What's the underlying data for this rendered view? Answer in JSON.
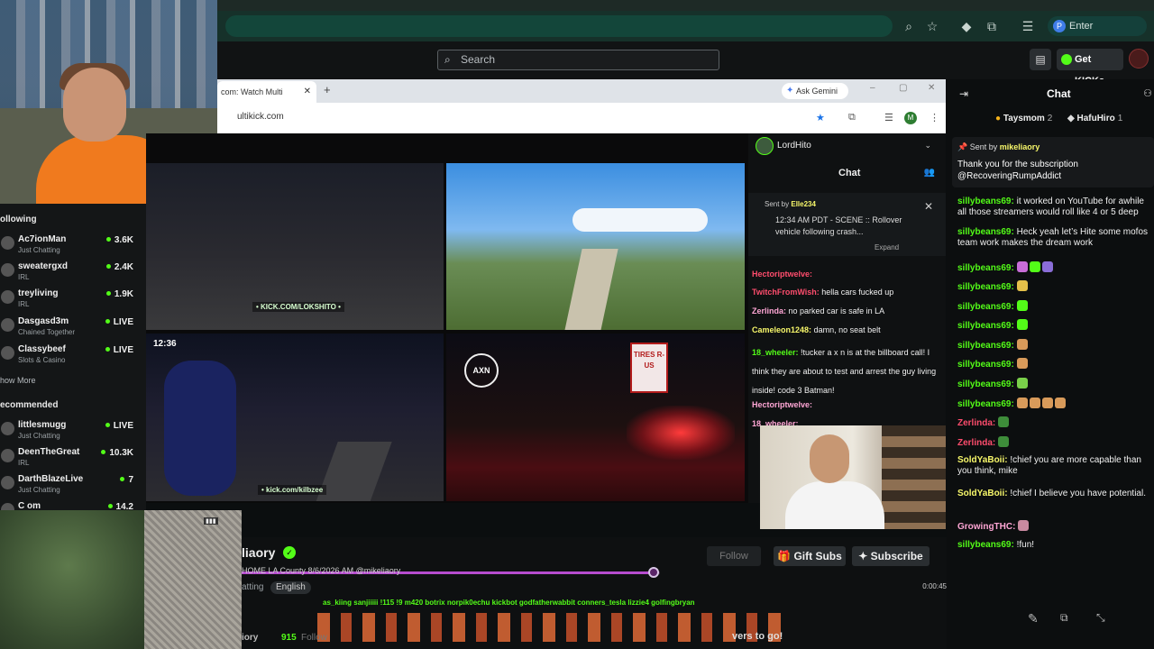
{
  "browser": {
    "passphrase_label": "Enter passphrase",
    "passphrase_badge": "P"
  },
  "kick": {
    "search_placeholder": "Search",
    "get_kicks_label": "Get KICKs"
  },
  "sidebar": {
    "following_title": "ollowing",
    "following": [
      {
        "name": "Ac7ionMan",
        "category": "Just Chatting",
        "viewers": "3.6K"
      },
      {
        "name": "sweatergxd",
        "category": "IRL",
        "viewers": "2.4K"
      },
      {
        "name": "treyliving",
        "category": "IRL",
        "viewers": "1.9K"
      },
      {
        "name": "Dasgasd3m",
        "category": "Chained Together",
        "viewers": "LIVE"
      },
      {
        "name": "Classybeef",
        "category": "Slots & Casino",
        "viewers": "LIVE"
      }
    ],
    "show_more": "how More",
    "recommended_title": "ecommended",
    "recommended": [
      {
        "name": "littlesmugg",
        "category": "Just Chatting",
        "viewers": "LIVE"
      },
      {
        "name": "DeenTheGreat",
        "category": "IRL",
        "viewers": "10.3K"
      },
      {
        "name": "DarthBlazeLive",
        "category": "Just Chatting",
        "viewers": "7"
      },
      {
        "name": "C   om",
        "category": "",
        "viewers": "14.2"
      }
    ]
  },
  "inner_browser": {
    "tab_title": "com: Watch Multi",
    "url": "ultikick.com",
    "ask_gemini": "Ask Gemini",
    "profile_initial": "M"
  },
  "streams": {
    "tile1_caption": "• KICK.COM/LOKSHITO •",
    "tile3_clock": "12:36",
    "tile3_caption": "• kick.com/kilbzee",
    "tile4_logo": "AXN",
    "tile4_sign": "TIRES R-US"
  },
  "inner_chat": {
    "user": "LordHito",
    "title": "Chat",
    "pinned_sender_label": "Sent by",
    "pinned_sender": "Elle234",
    "pinned_message": "12:34 AM PDT - SCENE :: Rollover vehicle following crash...",
    "expand_label": "Expand",
    "lines": [
      {
        "user": "Hectoriptwelve:",
        "text": ""
      },
      {
        "user": "TwitchFromWish:",
        "text": "hella cars fucked up"
      },
      {
        "user": "Zerlinda:",
        "text": "no parked car is safe in LA"
      },
      {
        "user": "Cameleon1248:",
        "text": "damn, no seat belt"
      },
      {
        "user": "18_wheeler:",
        "text": "!tucker a x n is at the billboard call! I think they are about to test and arrest the guy living inside! code 3 Batman!"
      },
      {
        "user": "Hectoriptwelve:",
        "text": ""
      },
      {
        "user": "18_wheeler:",
        "text": ""
      }
    ]
  },
  "info": {
    "streamer": "liaory",
    "title": "HOME LA County 8/6/2026 AM @mikeliaory",
    "category": "atting",
    "language": "English",
    "follow_label": "Follow",
    "gift_subs_label": "Gift Subs",
    "subscribe_label": "Subscribe",
    "overlay_names": "as_kiing    sanjiiiii  !115  !9   m420   botrix   norpik0echu   kickbot      godfatherwabbit   conners_tesla   lizzie4   golfingbryan",
    "footer_name": "iory",
    "footer_followers": "915",
    "footer_follow": "Follow",
    "footer_cta": "vers to go!",
    "time": "0:00:45",
    "progress": 0.985
  },
  "chat": {
    "title": "Chat",
    "gifters": [
      {
        "name": "Taysmom",
        "count": "2"
      },
      {
        "name": "HafuHiro",
        "count": "1"
      }
    ],
    "pinned_label": "Sent by",
    "pinned_sender": "mikeliaory",
    "pinned_message": "Thank you for the subscription @RecoveringRumpAddict",
    "lines": [
      {
        "user": "sillybeans69:",
        "text": "it worked on YouTube for awhile all those streamers would roll like 4 or 5 deep",
        "color": "green"
      },
      {
        "user": "sillybeans69:",
        "text": "Heck yeah let’s Hite some mofos team work makes the dream work",
        "color": "green"
      },
      {
        "user": "sillybeans69:",
        "text": "",
        "color": "green"
      },
      {
        "user": "sillybeans69:",
        "text": "",
        "color": "green"
      },
      {
        "user": "sillybeans69:",
        "text": "",
        "color": "green"
      },
      {
        "user": "sillybeans69:",
        "text": "",
        "color": "green"
      },
      {
        "user": "sillybeans69:",
        "text": "",
        "color": "green"
      },
      {
        "user": "sillybeans69:",
        "text": "",
        "color": "green"
      },
      {
        "user": "sillybeans69:",
        "text": "",
        "color": "green"
      },
      {
        "user": "sillybeans69:",
        "text": "",
        "color": "green"
      },
      {
        "user": "Zerlinda:",
        "text": "",
        "color": "red"
      },
      {
        "user": "Zerlinda:",
        "text": "",
        "color": "red"
      },
      {
        "user": "SoldYaBoii:",
        "text": "!chief you are more capable than you think, mike",
        "color": "yellow"
      },
      {
        "user": "SoldYaBoii:",
        "text": "!chief I believe you have potential.",
        "color": "yellow"
      },
      {
        "user": "GrowingTHC:",
        "text": "",
        "color": "pink"
      },
      {
        "user": "sillybeans69:",
        "text": "!fun!",
        "color": "green"
      }
    ]
  }
}
